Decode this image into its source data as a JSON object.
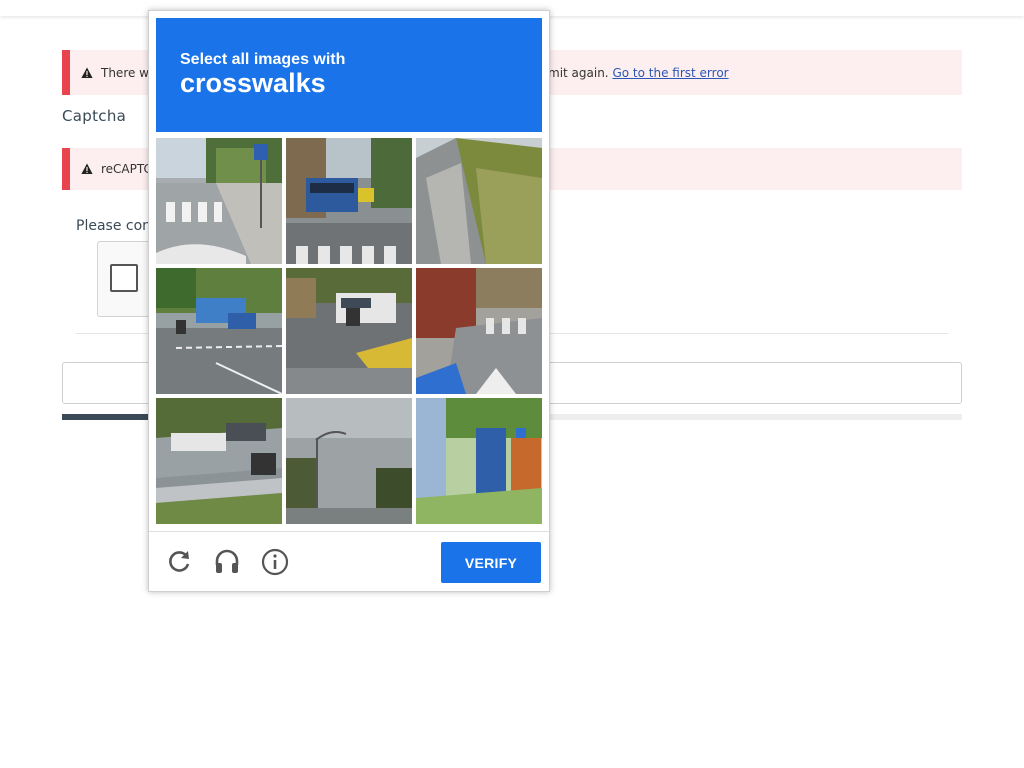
{
  "page": {
    "error_banner": {
      "text_visible_start": "There w",
      "text_visible_end": "mit again.",
      "link": "Go to the first error"
    },
    "section_title": "Captcha",
    "captcha_error": {
      "text_visible": "reCAPTC"
    },
    "prompt_text_visible": "Please con",
    "progress_fraction": 0.53
  },
  "challenge": {
    "instruction": "Select all images with",
    "target": "crosswalks",
    "tiles": [
      {
        "scene": "street-with-crosswalk-and-sign",
        "name": "tile-1"
      },
      {
        "scene": "bus-on-street-with-crosswalk",
        "name": "tile-2"
      },
      {
        "scene": "highway-retaining-wall",
        "name": "tile-3"
      },
      {
        "scene": "bus-and-cars-on-road",
        "name": "tile-4"
      },
      {
        "scene": "car-and-motorbike-at-intersection",
        "name": "tile-5"
      },
      {
        "scene": "sidewalk-with-crosswalk",
        "name": "tile-6"
      },
      {
        "scene": "cars-on-highway",
        "name": "tile-7"
      },
      {
        "scene": "street-with-trees",
        "name": "tile-8"
      },
      {
        "scene": "portable-toilet-park",
        "name": "tile-9"
      }
    ],
    "footer": {
      "reload_icon": "reload-icon",
      "audio_icon": "headphones-icon",
      "info_icon": "info-icon",
      "verify_label": "VERIFY"
    },
    "colors": {
      "brand_blue": "#1a73e8",
      "alert_red": "#e8444d",
      "alert_bg": "#fdeff0"
    }
  }
}
